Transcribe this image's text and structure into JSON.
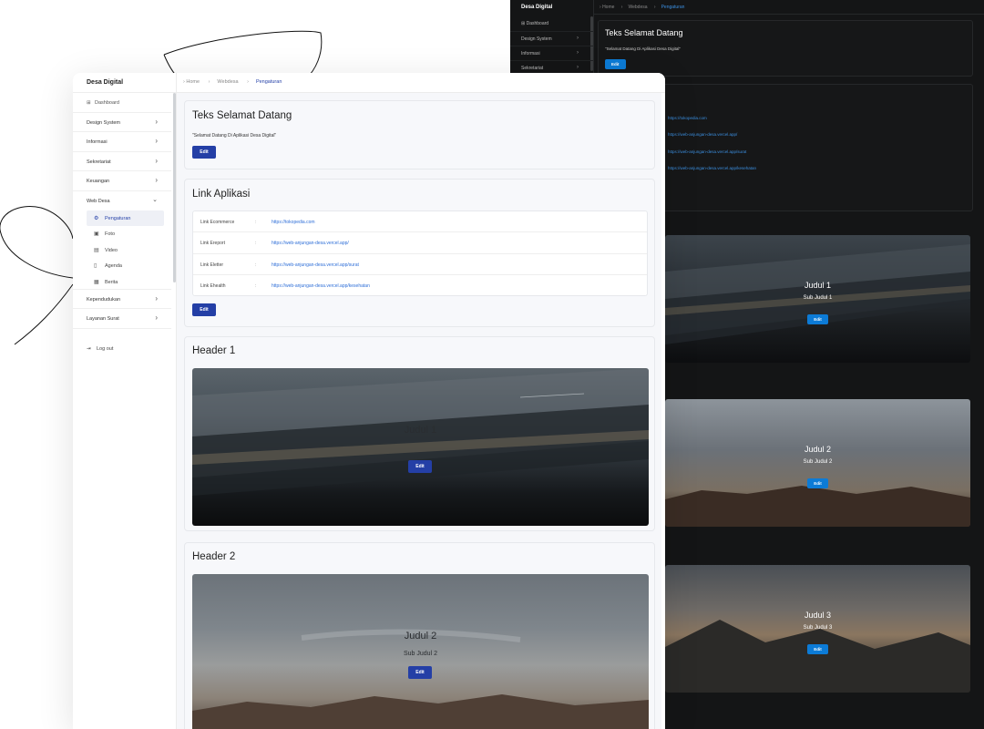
{
  "app": {
    "brand": "Desa Digital"
  },
  "breadcrumb": {
    "home": "Home",
    "webdesa": "Webdesa",
    "current": "Pengaturan"
  },
  "sidebar": {
    "dashboard": "Dashboard",
    "items": [
      {
        "label": "Design System"
      },
      {
        "label": "Informasi"
      },
      {
        "label": "Sekretariat"
      },
      {
        "label": "Keuangan"
      },
      {
        "label": "Web Desa"
      }
    ],
    "web_desa_sub": [
      {
        "label": "Pengaturan"
      },
      {
        "label": "Foto"
      },
      {
        "label": "Video"
      },
      {
        "label": "Agenda"
      },
      {
        "label": "Berita"
      }
    ],
    "more": [
      {
        "label": "Kependudukan"
      },
      {
        "label": "Layanan Surat"
      }
    ],
    "logout": "Log out"
  },
  "welcome": {
    "title": "Teks Selamat Datang",
    "text": "\"Selamat Datang Di Aplikasi Desa Digital\"",
    "edit": "Edit"
  },
  "links": {
    "title": "Link Aplikasi",
    "separator": ":",
    "rows": [
      {
        "label": "Link Ecommerce",
        "url": "https://tokopedia.com"
      },
      {
        "label": "Link Ereport",
        "url": "https://web-anjungan-desa.vercel.app/"
      },
      {
        "label": "Link Eletter",
        "url": "https://web-anjungan-desa.vercel.app/surat"
      },
      {
        "label": "Link Ehealth",
        "url": "https://web-anjungan-desa.vercel.app/kesehatan"
      }
    ],
    "edit": "Edit"
  },
  "header1": {
    "title": "Header 1",
    "heading": "Judul 1",
    "sub": "Sub Judul 1",
    "edit": "Edit"
  },
  "header2": {
    "title": "Header 2",
    "heading": "Judul 2",
    "sub": "Sub Judul 2",
    "edit": "Edit"
  },
  "header3": {
    "heading": "Judul 3",
    "sub": "Sub Judul 3",
    "edit": "Edit"
  },
  "colors": {
    "primary": "#243fa6",
    "dark_primary": "#0c7bd6",
    "link": "#2f6fd8"
  }
}
